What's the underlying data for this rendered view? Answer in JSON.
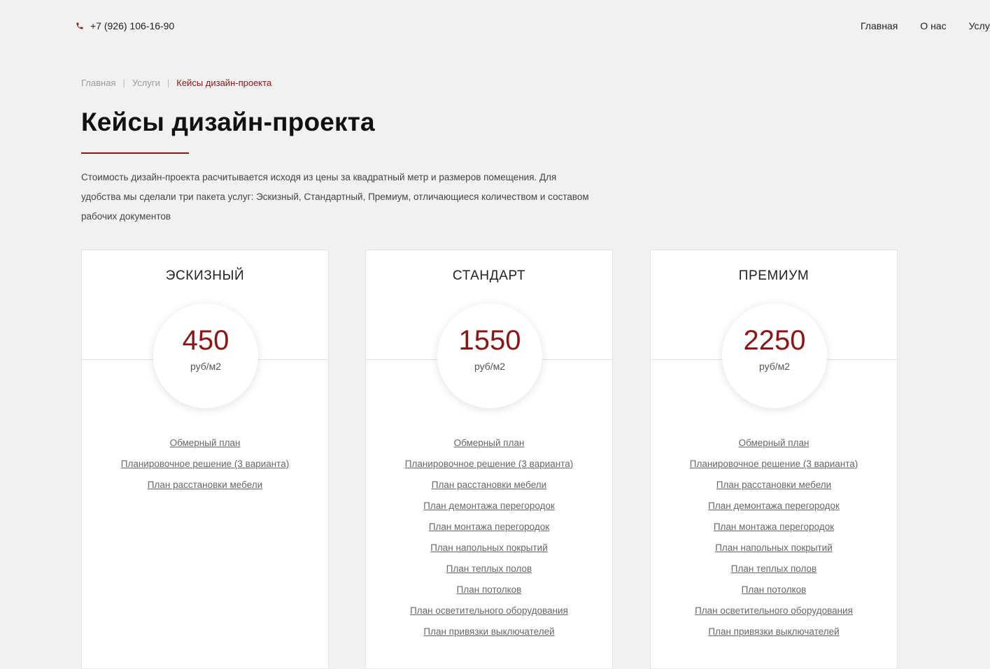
{
  "header": {
    "phone": "+7 (926) 106-16-90",
    "nav": [
      "Главная",
      "О нас",
      "Услуги"
    ]
  },
  "breadcrumb": {
    "home": "Главная",
    "services": "Услуги",
    "current": "Кейсы дизайн-проекта"
  },
  "page": {
    "title": "Кейсы дизайн-проекта",
    "intro": "Стоимость дизайн-проекта расчитывается исходя из цены за квадратный метр и размеров помещения. Для удобства мы сделали три пакета услуг: Эскизный, Стандартный, Премиум, отличающиеся количеством и составом рабочих документов"
  },
  "colors": {
    "accent": "#8b1414",
    "background": "#f1f1f1"
  },
  "plans": [
    {
      "name": "ЭСКИЗНЫЙ",
      "price": "450",
      "unit": "руб/м2",
      "features": [
        "Обмерный план",
        "Планировочное решение (3 варианта)",
        "План расстановки мебели"
      ]
    },
    {
      "name": "СТАНДАРТ",
      "price": "1550",
      "unit": "руб/м2",
      "features": [
        "Обмерный план",
        "Планировочное решение (3 варианта)",
        "План расстановки мебели",
        "План демонтажа перегородок",
        "План монтажа перегородок",
        "План напольных покрытий",
        "План теплых полов",
        "План потолков",
        "План осветительного оборудования",
        "План привязки выключателей"
      ]
    },
    {
      "name": "ПРЕМИУМ",
      "price": "2250",
      "unit": "руб/м2",
      "features": [
        "Обмерный план",
        "Планировочное решение (3 варианта)",
        "План расстановки мебели",
        "План демонтажа перегородок",
        "План монтажа перегородок",
        "План напольных покрытий",
        "План теплых полов",
        "План потолков",
        "План осветительного оборудования",
        "План привязки выключателей"
      ]
    }
  ]
}
